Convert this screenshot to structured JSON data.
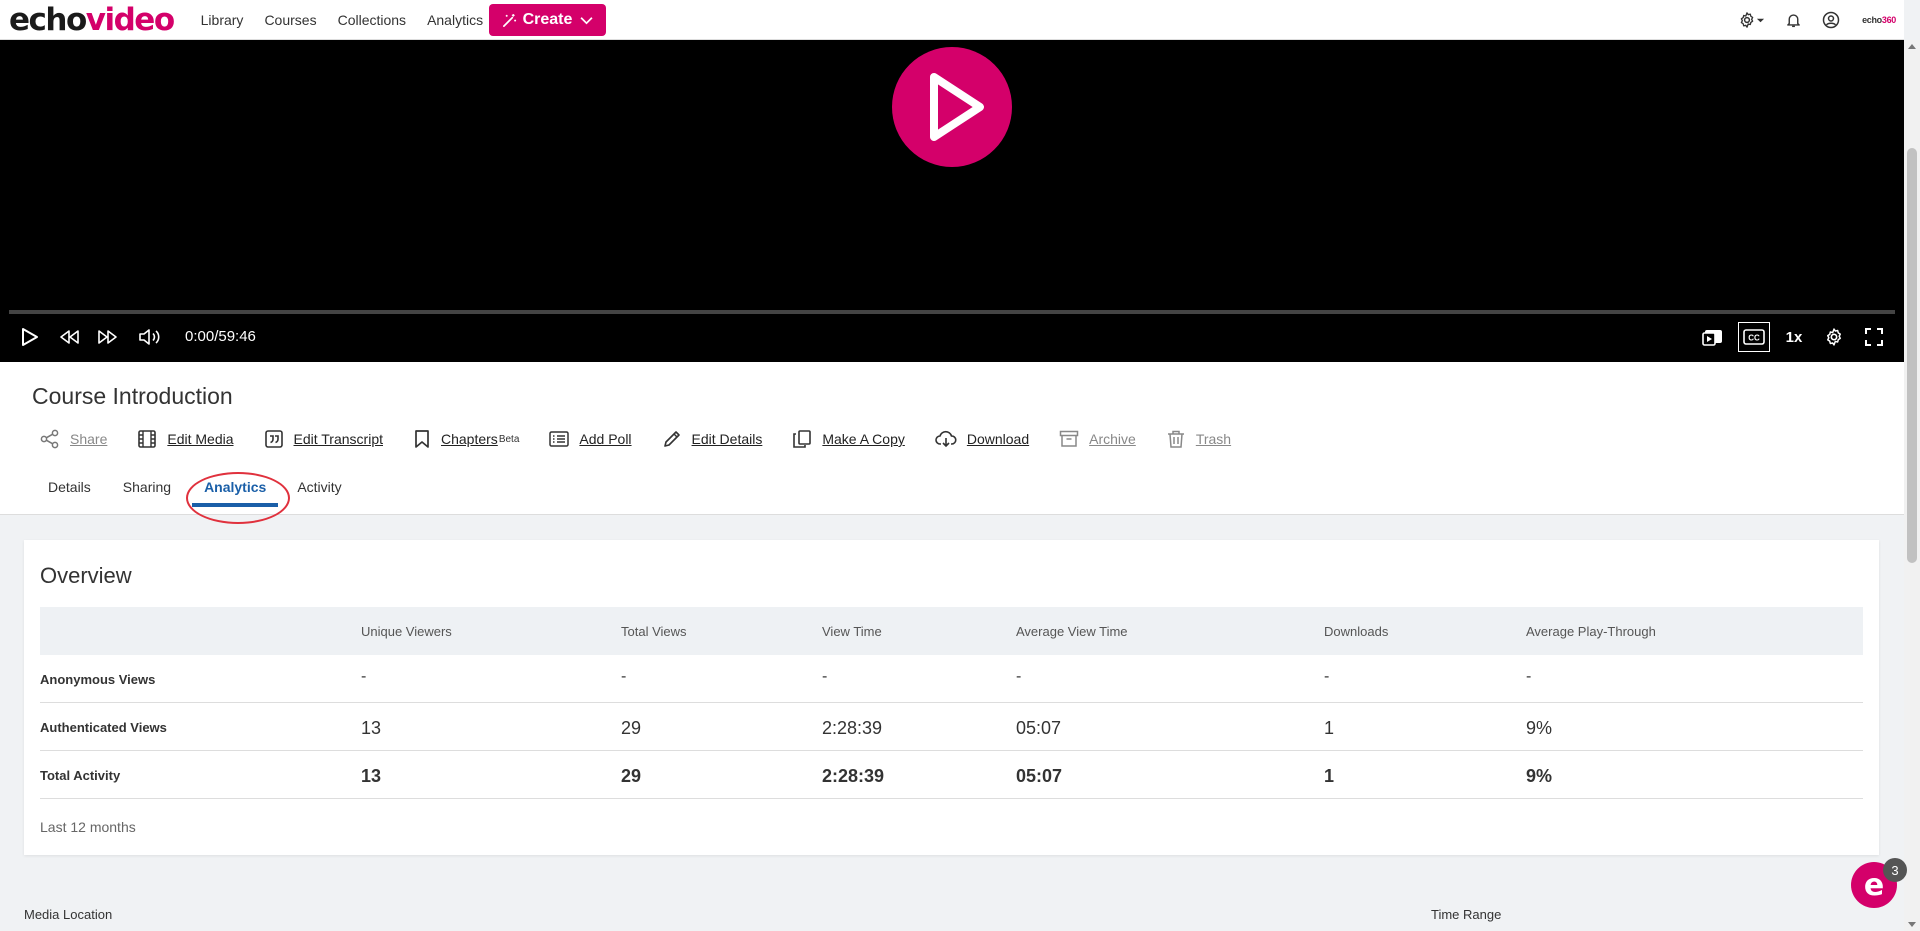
{
  "app": {
    "logo_echo": "echo",
    "logo_video": "video",
    "brand_color": "#d4006a",
    "brand_right_a": "echo",
    "brand_right_b": "360"
  },
  "nav": {
    "items": [
      {
        "label": "Library"
      },
      {
        "label": "Courses"
      },
      {
        "label": "Collections"
      },
      {
        "label": "Analytics"
      }
    ],
    "create_label": "Create",
    "icons": [
      "settings-gear-icon",
      "bell-icon",
      "user-circle-icon"
    ]
  },
  "player": {
    "time": "0:00/59:46",
    "speed": "1x",
    "progress": 0
  },
  "media": {
    "title": "Course Introduction",
    "actions": [
      {
        "label": "Share",
        "icon": "share-icon",
        "enabled": false
      },
      {
        "label": "Edit Media",
        "icon": "film-icon",
        "enabled": true
      },
      {
        "label": "Edit Transcript",
        "icon": "quote-icon",
        "enabled": true
      },
      {
        "label": "Chapters",
        "sup": "Beta",
        "icon": "bookmark-icon",
        "enabled": true
      },
      {
        "label": "Add Poll",
        "icon": "list-icon",
        "enabled": true
      },
      {
        "label": "Edit Details",
        "icon": "pencil-icon",
        "enabled": true
      },
      {
        "label": "Make A Copy",
        "icon": "copy-icon",
        "enabled": true
      },
      {
        "label": "Download",
        "icon": "cloud-download-icon",
        "enabled": true
      },
      {
        "label": "Archive",
        "icon": "archive-icon",
        "enabled": false
      },
      {
        "label": "Trash",
        "icon": "trash-icon",
        "enabled": false
      }
    ],
    "tabs": [
      {
        "label": "Details"
      },
      {
        "label": "Sharing"
      },
      {
        "label": "Analytics",
        "active": true
      },
      {
        "label": "Activity"
      }
    ]
  },
  "overview": {
    "title": "Overview",
    "columns": [
      "Unique Viewers",
      "Total Views",
      "View Time",
      "Average View Time",
      "Downloads",
      "Average Play-Through"
    ],
    "rows": [
      {
        "label": "Anonymous Views",
        "values": [
          "-",
          "-",
          "-",
          "-",
          "-",
          "-"
        ]
      },
      {
        "label": "Authenticated Views",
        "values": [
          "13",
          "29",
          "2:28:39",
          "05:07",
          "1",
          "9%"
        ]
      },
      {
        "label": "Total Activity",
        "values": [
          "13",
          "29",
          "2:28:39",
          "05:07",
          "1",
          "9%"
        ]
      }
    ],
    "footnote": "Last 12 months"
  },
  "below": {
    "media_location": "Media Location",
    "time_range": "Time Range"
  },
  "chat": {
    "glyph": "e",
    "badge": "3"
  }
}
